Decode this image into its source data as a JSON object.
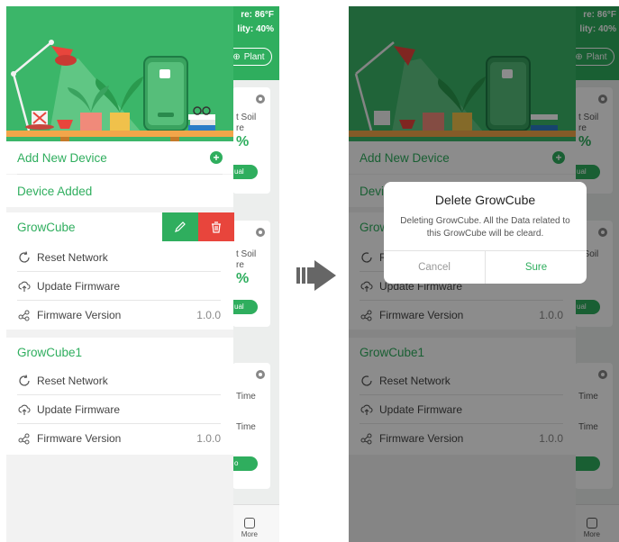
{
  "background_app": {
    "temperature_text": "re: 86°F",
    "humidity_text": "lity: 40%",
    "plant_button": "Plant",
    "card1_text": [
      "t Soil",
      "re"
    ],
    "card1_pct": "%",
    "card2_text": [
      "t Soil",
      "re"
    ],
    "card2_pct": "%",
    "card3_text": [
      "Time",
      "Time"
    ],
    "more_label": "More"
  },
  "drawer": {
    "add_new_device": "Add New Device",
    "device_added": "Device Added",
    "devices": [
      {
        "name": "GrowCube",
        "reset_network": "Reset Network",
        "update_firmware": "Update Firmware",
        "firmware_version_label": "Firmware Version",
        "firmware_version": "1.0.0"
      },
      {
        "name": "GrowCube1",
        "reset_network": "Reset Network",
        "update_firmware": "Update Firmware",
        "firmware_version_label": "Firmware Version",
        "firmware_version": "1.0.0"
      }
    ],
    "device_logo_text": "GrowCube"
  },
  "dialog": {
    "title": "Delete GrowCube",
    "message": "Deleting GrowCube. All the Data related to this GrowCube will be cleard.",
    "cancel": "Cancel",
    "confirm": "Sure"
  },
  "colors": {
    "accent": "#2fae5e",
    "danger": "#e8453c",
    "banner": "#3bb669"
  },
  "icons": [
    "plus-icon",
    "edit-icon",
    "trash-icon",
    "reset-icon",
    "upload-cloud-icon",
    "share-nodes-icon",
    "arrow-right-icon"
  ]
}
